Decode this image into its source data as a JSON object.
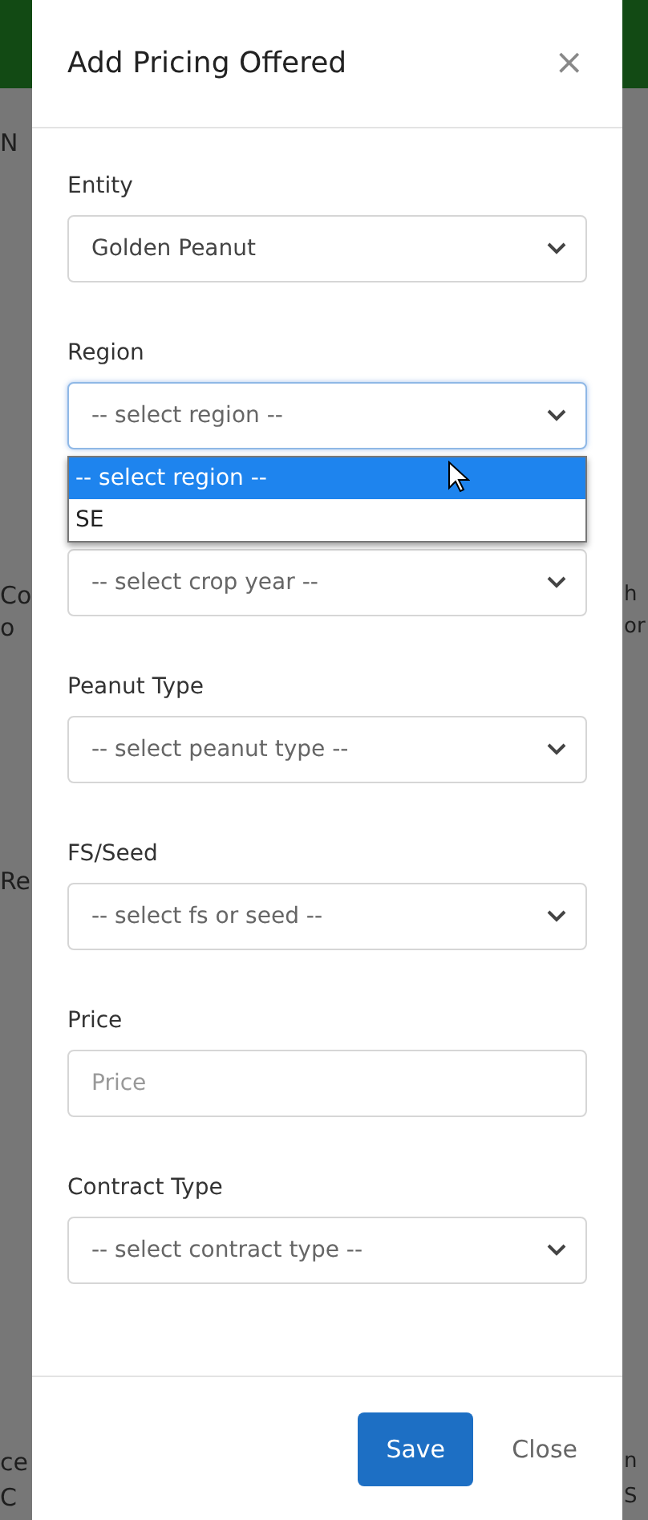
{
  "background": {
    "left_fragments": [
      "N",
      "Co",
      "o",
      "Re",
      "ce",
      "C"
    ],
    "right_fragments": [
      "h",
      "or",
      "n",
      "S"
    ]
  },
  "modal": {
    "title": "Add Pricing Offered",
    "close_icon": "×",
    "fields": [
      {
        "kind": "select",
        "label": "Entity",
        "value": "Golden Peanut"
      },
      {
        "kind": "select",
        "label": "Region",
        "value": "-- select region --",
        "open": true,
        "options": [
          {
            "label": "-- select region --",
            "selected": true
          },
          {
            "label": "SE",
            "selected": false
          }
        ]
      },
      {
        "kind": "select",
        "value": "-- select crop year --"
      },
      {
        "kind": "select",
        "label": "Peanut Type",
        "value": "-- select peanut type --"
      },
      {
        "kind": "select",
        "label": "FS/Seed",
        "value": "-- select fs or seed --"
      },
      {
        "kind": "input",
        "label": "Price",
        "placeholder": "Price"
      },
      {
        "kind": "select",
        "label": "Contract Type",
        "value": "-- select contract type --"
      }
    ],
    "buttons": [
      {
        "kind": "primary",
        "label": "Save"
      },
      {
        "kind": "plain",
        "label": "Close"
      }
    ]
  }
}
